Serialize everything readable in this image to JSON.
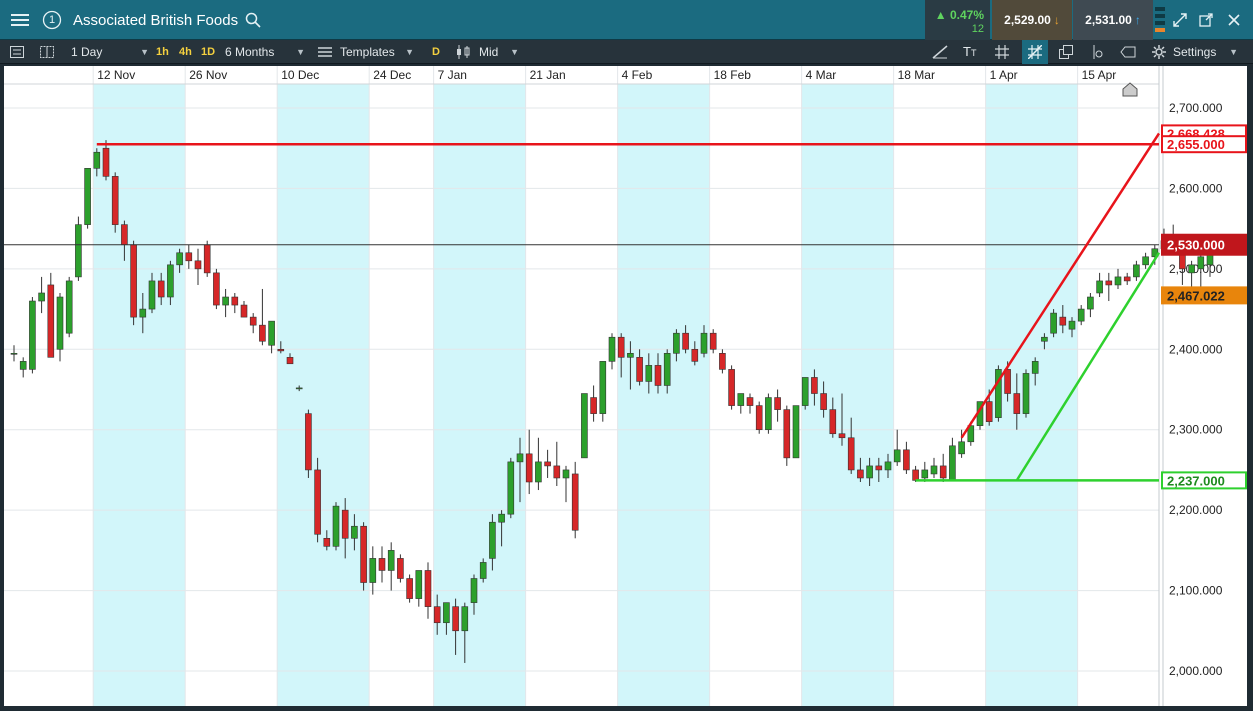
{
  "header": {
    "title": "Associated British Foods",
    "badge": "1",
    "change_pct": "0.47%",
    "change_pts": "12",
    "sell_price": "2,529.00",
    "buy_price": "2,531.00"
  },
  "toolbar": {
    "interval": "1 Day",
    "quick_1h": "1h",
    "quick_4h": "4h",
    "quick_1d": "1D",
    "range": "6 Months",
    "templates": "Templates",
    "d_badge": "D",
    "price_type": "Mid",
    "settings": "Settings"
  },
  "colors": {
    "up": "#2ca02c",
    "down": "#d62728",
    "shade": "#d2f6fa",
    "resistance": "#e8141b",
    "support": "#2ed12e",
    "current_label": "#c0161c",
    "marker_label": "#e8850c"
  },
  "chart_data": {
    "type": "candlestick",
    "instrument": "Associated British Foods",
    "interval": "1 Day",
    "ylim": [
      1975,
      2735
    ],
    "y_ticks": [
      {
        "v": 2700,
        "label": "2,700.000"
      },
      {
        "v": 2600,
        "label": "2,600.000"
      },
      {
        "v": 2500,
        "label": "2,500.000"
      },
      {
        "v": 2400,
        "label": "2,400.000"
      },
      {
        "v": 2300,
        "label": "2,300.000"
      },
      {
        "v": 2200,
        "label": "2,200.000"
      },
      {
        "v": 2100,
        "label": "2,100.000"
      },
      {
        "v": 2000,
        "label": "2,000.000"
      }
    ],
    "x_labels": [
      {
        "label": "12 Nov",
        "i": 9
      },
      {
        "label": "26 Nov",
        "i": 19
      },
      {
        "label": "10 Dec",
        "i": 29
      },
      {
        "label": "24 Dec",
        "i": 39
      },
      {
        "label": "7 Jan",
        "i": 46
      },
      {
        "label": "21 Jan",
        "i": 56
      },
      {
        "label": "4 Feb",
        "i": 66
      },
      {
        "label": "18 Feb",
        "i": 76
      },
      {
        "label": "4 Mar",
        "i": 86
      },
      {
        "label": "18 Mar",
        "i": 96
      },
      {
        "label": "1 Apr",
        "i": 106
      },
      {
        "label": "15 Apr",
        "i": 116
      }
    ],
    "shaded_ranges": [
      [
        9,
        19
      ],
      [
        29,
        39
      ],
      [
        46,
        56
      ],
      [
        66,
        76
      ],
      [
        86,
        96
      ],
      [
        106,
        116
      ]
    ],
    "candles": [
      [
        2395,
        2405,
        2385,
        2395
      ],
      [
        2375,
        2390,
        2365,
        2385
      ],
      [
        2375,
        2465,
        2370,
        2460
      ],
      [
        2460,
        2490,
        2445,
        2470
      ],
      [
        2480,
        2495,
        2390,
        2390
      ],
      [
        2400,
        2470,
        2385,
        2465
      ],
      [
        2420,
        2490,
        2415,
        2485
      ],
      [
        2490,
        2565,
        2485,
        2555
      ],
      [
        2555,
        2625,
        2550,
        2625
      ],
      [
        2625,
        2650,
        2615,
        2645
      ],
      [
        2650,
        2660,
        2610,
        2615
      ],
      [
        2615,
        2620,
        2545,
        2555
      ],
      [
        2555,
        2560,
        2510,
        2530
      ],
      [
        2530,
        2535,
        2430,
        2440
      ],
      [
        2440,
        2470,
        2420,
        2450
      ],
      [
        2450,
        2495,
        2445,
        2485
      ],
      [
        2485,
        2495,
        2455,
        2465
      ],
      [
        2465,
        2510,
        2455,
        2505
      ],
      [
        2505,
        2525,
        2495,
        2520
      ],
      [
        2520,
        2530,
        2500,
        2510
      ],
      [
        2510,
        2525,
        2480,
        2500
      ],
      [
        2530,
        2535,
        2490,
        2495
      ],
      [
        2495,
        2500,
        2450,
        2455
      ],
      [
        2455,
        2475,
        2440,
        2465
      ],
      [
        2465,
        2470,
        2445,
        2455
      ],
      [
        2455,
        2460,
        2440,
        2440
      ],
      [
        2440,
        2445,
        2420,
        2430
      ],
      [
        2430,
        2475,
        2405,
        2410
      ],
      [
        2405,
        2435,
        2395,
        2435
      ],
      [
        2400,
        2410,
        2395,
        2398
      ],
      [
        2390,
        2395,
        2382,
        2382
      ],
      [
        2352,
        2355,
        2348,
        2352
      ],
      [
        2320,
        2325,
        2240,
        2250
      ],
      [
        2250,
        2265,
        2160,
        2170
      ],
      [
        2165,
        2175,
        2150,
        2155
      ],
      [
        2155,
        2210,
        2150,
        2205
      ],
      [
        2200,
        2215,
        2140,
        2165
      ],
      [
        2165,
        2195,
        2150,
        2180
      ],
      [
        2180,
        2185,
        2100,
        2110
      ],
      [
        2110,
        2155,
        2095,
        2140
      ],
      [
        2140,
        2155,
        2110,
        2125
      ],
      [
        2125,
        2160,
        2100,
        2150
      ],
      [
        2140,
        2145,
        2110,
        2115
      ],
      [
        2115,
        2120,
        2085,
        2090
      ],
      [
        2090,
        2125,
        2080,
        2125
      ],
      [
        2125,
        2135,
        2065,
        2080
      ],
      [
        2080,
        2095,
        2045,
        2060
      ],
      [
        2060,
        2085,
        2045,
        2085
      ],
      [
        2080,
        2090,
        2020,
        2050
      ],
      [
        2050,
        2085,
        2010,
        2080
      ],
      [
        2085,
        2120,
        2070,
        2115
      ],
      [
        2115,
        2140,
        2110,
        2135
      ],
      [
        2140,
        2195,
        2125,
        2185
      ],
      [
        2185,
        2200,
        2155,
        2195
      ],
      [
        2195,
        2265,
        2190,
        2260
      ],
      [
        2260,
        2290,
        2210,
        2270
      ],
      [
        2270,
        2300,
        2220,
        2235
      ],
      [
        2235,
        2290,
        2225,
        2260
      ],
      [
        2260,
        2275,
        2240,
        2255
      ],
      [
        2255,
        2285,
        2230,
        2240
      ],
      [
        2240,
        2255,
        2210,
        2250
      ],
      [
        2245,
        2260,
        2165,
        2175
      ],
      [
        2265,
        2345,
        2265,
        2345
      ],
      [
        2340,
        2355,
        2310,
        2320
      ],
      [
        2320,
        2385,
        2310,
        2385
      ],
      [
        2385,
        2420,
        2375,
        2415
      ],
      [
        2415,
        2420,
        2365,
        2390
      ],
      [
        2390,
        2410,
        2350,
        2395
      ],
      [
        2390,
        2400,
        2355,
        2360
      ],
      [
        2360,
        2395,
        2345,
        2380
      ],
      [
        2380,
        2395,
        2345,
        2355
      ],
      [
        2355,
        2400,
        2345,
        2395
      ],
      [
        2395,
        2425,
        2385,
        2420
      ],
      [
        2420,
        2430,
        2395,
        2400
      ],
      [
        2400,
        2410,
        2380,
        2385
      ],
      [
        2395,
        2430,
        2390,
        2420
      ],
      [
        2420,
        2425,
        2395,
        2400
      ],
      [
        2395,
        2400,
        2370,
        2375
      ],
      [
        2375,
        2380,
        2325,
        2330
      ],
      [
        2330,
        2345,
        2320,
        2345
      ],
      [
        2340,
        2345,
        2320,
        2330
      ],
      [
        2330,
        2335,
        2295,
        2300
      ],
      [
        2300,
        2345,
        2295,
        2340
      ],
      [
        2340,
        2350,
        2310,
        2325
      ],
      [
        2325,
        2330,
        2255,
        2265
      ],
      [
        2265,
        2330,
        2265,
        2330
      ],
      [
        2330,
        2365,
        2325,
        2365
      ],
      [
        2365,
        2375,
        2330,
        2345
      ],
      [
        2345,
        2360,
        2315,
        2325
      ],
      [
        2325,
        2340,
        2290,
        2295
      ],
      [
        2295,
        2345,
        2280,
        2290
      ],
      [
        2290,
        2315,
        2245,
        2250
      ],
      [
        2250,
        2265,
        2235,
        2240
      ],
      [
        2240,
        2265,
        2230,
        2255
      ],
      [
        2255,
        2265,
        2235,
        2250
      ],
      [
        2250,
        2270,
        2240,
        2260
      ],
      [
        2260,
        2300,
        2255,
        2275
      ],
      [
        2275,
        2285,
        2245,
        2250
      ],
      [
        2250,
        2255,
        2235,
        2237
      ],
      [
        2240,
        2260,
        2235,
        2250
      ],
      [
        2245,
        2265,
        2240,
        2255
      ],
      [
        2255,
        2270,
        2235,
        2240
      ],
      [
        2237,
        2290,
        2237,
        2280
      ],
      [
        2270,
        2300,
        2265,
        2285
      ],
      [
        2285,
        2310,
        2280,
        2305
      ],
      [
        2305,
        2335,
        2300,
        2335
      ],
      [
        2335,
        2350,
        2305,
        2310
      ],
      [
        2315,
        2380,
        2310,
        2375
      ],
      [
        2375,
        2385,
        2335,
        2345
      ],
      [
        2345,
        2370,
        2300,
        2320
      ],
      [
        2320,
        2375,
        2315,
        2370
      ],
      [
        2370,
        2390,
        2355,
        2385
      ],
      [
        2410,
        2420,
        2400,
        2415
      ],
      [
        2420,
        2450,
        2415,
        2445
      ],
      [
        2440,
        2455,
        2420,
        2430
      ],
      [
        2425,
        2440,
        2415,
        2435
      ],
      [
        2435,
        2455,
        2430,
        2450
      ],
      [
        2450,
        2470,
        2440,
        2465
      ],
      [
        2470,
        2495,
        2465,
        2485
      ],
      [
        2485,
        2495,
        2460,
        2480
      ],
      [
        2480,
        2500,
        2475,
        2490
      ],
      [
        2490,
        2495,
        2480,
        2485
      ],
      [
        2490,
        2510,
        2485,
        2505
      ],
      [
        2505,
        2520,
        2500,
        2515
      ],
      [
        2515,
        2530,
        2505,
        2525
      ],
      [
        2525,
        2550,
        2520,
        2535
      ],
      [
        2535,
        2555,
        2525,
        2530
      ],
      [
        2525,
        2535,
        2480,
        2500
      ],
      [
        2495,
        2510,
        2470,
        2505
      ],
      [
        2500,
        2525,
        2475,
        2515
      ],
      [
        2505,
        2535,
        2490,
        2530
      ]
    ],
    "lines": [
      {
        "kind": "resistance-horizontal",
        "color": "red",
        "from": [
          9,
          2655
        ],
        "to": "right-edge",
        "value": 2655
      },
      {
        "kind": "rising-channel-top",
        "color": "red",
        "from": [
          103,
          2290
        ],
        "to": "right-edge",
        "end_value": 2668.428
      },
      {
        "kind": "rising-channel-bottom",
        "color": "green",
        "from": [
          109,
          2237
        ],
        "to": "right-edge",
        "end_value": 2520
      },
      {
        "kind": "support-horizontal",
        "color": "green",
        "from": [
          98,
          2237
        ],
        "to": "right-edge",
        "value": 2237
      }
    ],
    "current_price": 2530,
    "price_labels": [
      {
        "value": 2668.428,
        "label": "2,668.428",
        "style": "outline-red"
      },
      {
        "value": 2655,
        "label": "2,655.000",
        "style": "outline-red-under"
      },
      {
        "value": 2530,
        "label": "2,530.000",
        "style": "current"
      },
      {
        "value": 2467.022,
        "label": "2,467.022",
        "style": "orange"
      },
      {
        "value": 2237,
        "label": "2,237.000",
        "style": "outline-green"
      }
    ]
  }
}
